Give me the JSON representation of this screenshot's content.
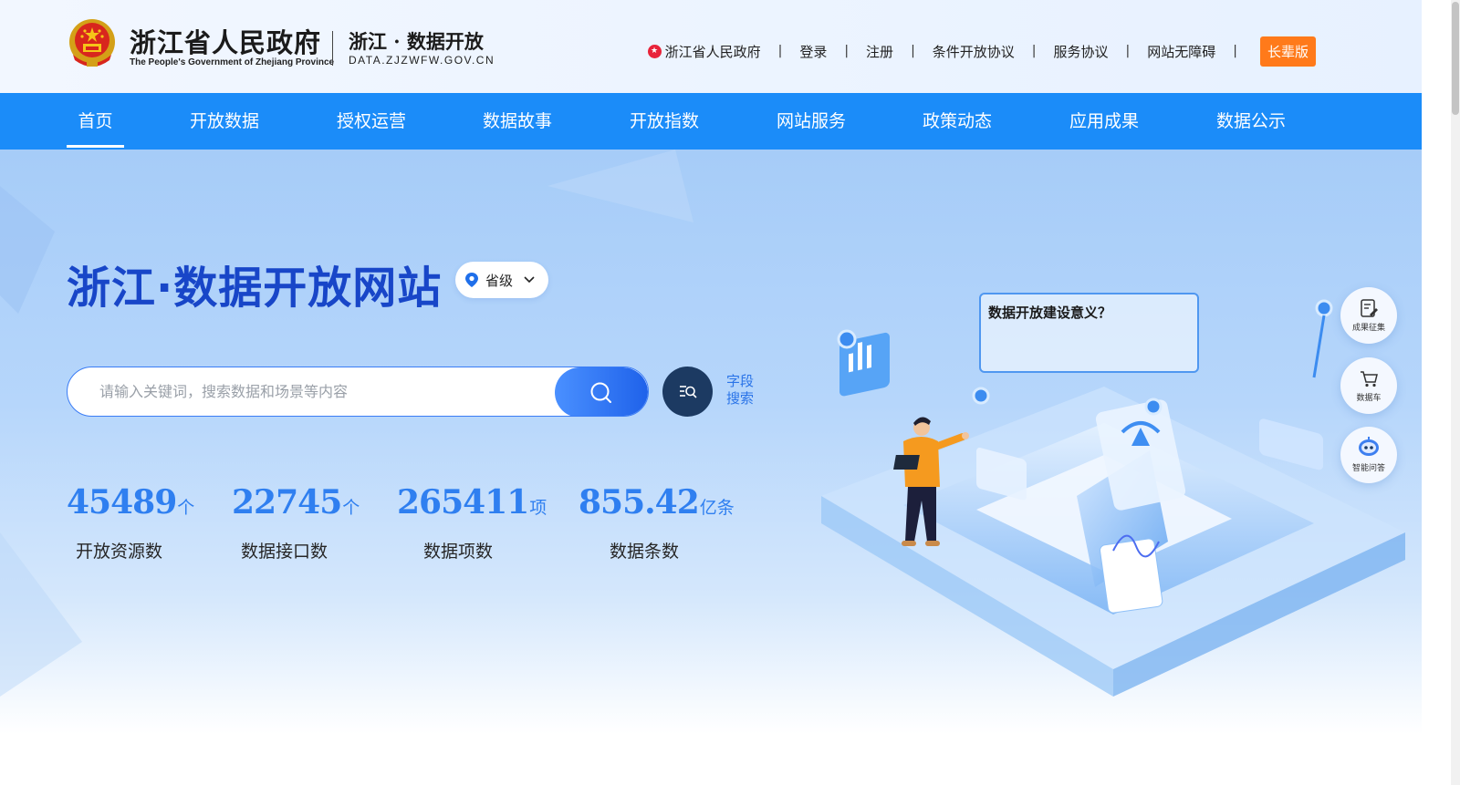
{
  "header": {
    "gov_name": "浙江省人民政府",
    "gov_name_en": "The People's Government of Zhejiang Province",
    "site_name": "浙江 · 数据开放",
    "site_domain": "DATA.ZJZWFW.GOV.CN",
    "links": [
      "浙江省人民政府",
      "登录",
      "注册",
      "条件开放协议",
      "服务协议",
      "网站无障碍"
    ],
    "link_separator": "|",
    "elder_mode": "长辈版"
  },
  "nav": {
    "items": [
      "首页",
      "开放数据",
      "授权运营",
      "数据故事",
      "开放指数",
      "网站服务",
      "政策动态",
      "应用成果",
      "数据公示"
    ],
    "active_index": 0
  },
  "hero": {
    "title": "浙江·数据开放网站",
    "region": "省级",
    "search_placeholder": "请输入关键词，搜索数据和场景等内容",
    "field_search_label": "字段搜索",
    "stats": [
      {
        "value": "45489",
        "unit": "个",
        "label": "开放资源数"
      },
      {
        "value": "22745",
        "unit": "个",
        "label": "数据接口数"
      },
      {
        "value": "265411",
        "unit": "项",
        "label": "数据项数"
      },
      {
        "value": "855.42",
        "unit": "亿条",
        "label": "数据条数"
      }
    ],
    "bubble_text": "数据开放建设意义？"
  },
  "side_tools": [
    "成果征集",
    "数据车",
    "智能问答"
  ],
  "colors": {
    "nav_bg": "#1b8cf9",
    "title_blue": "#1846c8",
    "stat_blue": "#2f7ff0",
    "elder_orange": "#ff7a1a",
    "field_btn": "#1c3a62"
  }
}
